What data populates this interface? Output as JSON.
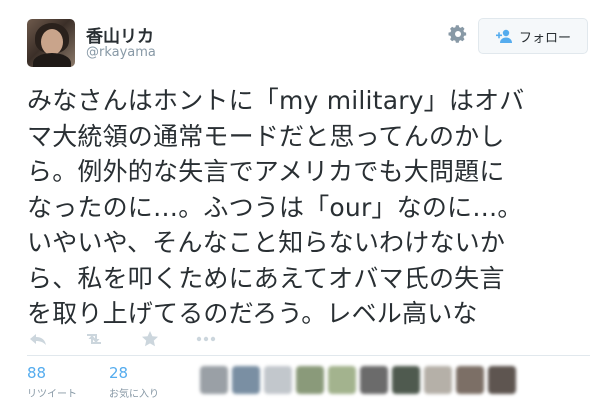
{
  "author": {
    "display_name": "香山リカ",
    "handle": "@rkayama"
  },
  "header": {
    "follow_label": "フォロー",
    "gear_icon": "gear-icon",
    "follow_icon": "add-user-icon"
  },
  "tweet": {
    "lines": [
      "みなさんはホントに「my military」はオバ",
      "マ大統領の通常モードだと思ってんのかし",
      "ら。例外的な失言でアメリカでも大問題に",
      "なったのに…。ふつうは「our」なのに…。",
      "いやいや、そんなこと知らないわけないか",
      "ら、私を叩くためにあえてオバマ氏の失言",
      "を取り上げてるのだろう。レベル高いな"
    ]
  },
  "actions": {
    "reply_icon": "reply-icon",
    "retweet_icon": "retweet-icon",
    "favorite_icon": "star-icon",
    "more_icon": "more-icon"
  },
  "stats": {
    "retweets": {
      "count": "88",
      "label": "リツイート"
    },
    "favorites": {
      "count": "28",
      "label": "お気に入り"
    }
  },
  "colors": {
    "accent": "#55acee",
    "text": "#292f33",
    "muted": "#8899a6",
    "border": "#e1e8ed"
  },
  "favoriter_avatars": [
    "#9aa0a6",
    "#7a8fa3",
    "#c2c7cc",
    "#8a9a7a",
    "#a3b38e",
    "#6b6b6b",
    "#4f5a4f",
    "#b5b0a8",
    "#7c6f66",
    "#5e5550"
  ]
}
